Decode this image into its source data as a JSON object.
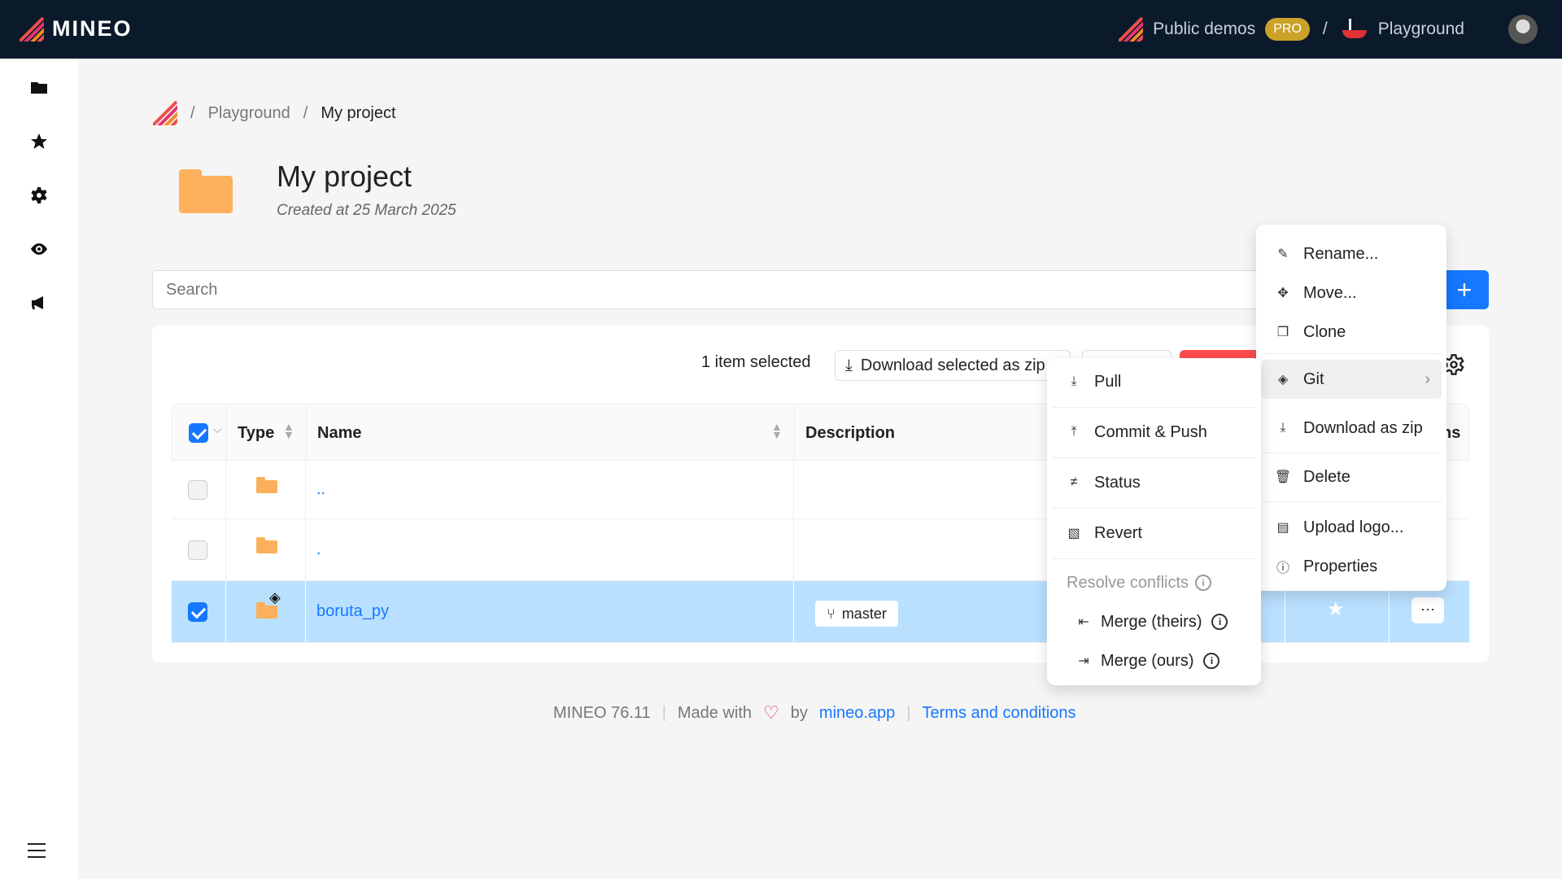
{
  "topbar": {
    "app_name": "MINEO",
    "org": "Public demos",
    "org_badge": "PRO",
    "separator": "/",
    "workspace": "Playground"
  },
  "breadcrumb": {
    "sep1": "/",
    "item1": "Playground",
    "sep2": "/",
    "item2": "My project"
  },
  "header": {
    "title": "My project",
    "subtitle": "Created at 25 March 2025"
  },
  "search": {
    "placeholder": "Search"
  },
  "toolbar": {
    "selection": "1 item selected",
    "download_label": "Download selected as zip"
  },
  "table": {
    "columns": [
      "Type",
      "Name",
      "Description",
      "ns"
    ],
    "rows": [
      {
        "name": "..",
        "selected": false
      },
      {
        "name": ".",
        "selected": false
      },
      {
        "name": "boruta_py",
        "branch": "master",
        "selected": true
      }
    ]
  },
  "context_menu": {
    "items": [
      "Rename...",
      "Move...",
      "Clone",
      "Git",
      "Download as zip",
      "Delete",
      "Upload logo...",
      "Properties"
    ]
  },
  "git_menu": {
    "items": [
      "Pull",
      "Commit & Push",
      "Status",
      "Revert"
    ],
    "section": "Resolve conflicts",
    "merge_theirs": "Merge (theirs)",
    "merge_ours": "Merge (ours)"
  },
  "footer": {
    "version": "MINEO 76.11",
    "made_with": "Made with",
    "by": "by",
    "site": "mineo.app",
    "terms": "Terms and conditions"
  },
  "colors": {
    "topbar": "#0b1a2b",
    "accent": "#1677ff",
    "folder": "#fdb05b",
    "selected_row": "#bae0ff",
    "pro": "#c9a227"
  },
  "icons": [
    "folder-icon",
    "star-icon",
    "gear-icon",
    "eye-icon",
    "megaphone-icon",
    "menu-icon",
    "plus-icon",
    "download-icon",
    "git-icon",
    "branch-icon",
    "info-icon"
  ]
}
